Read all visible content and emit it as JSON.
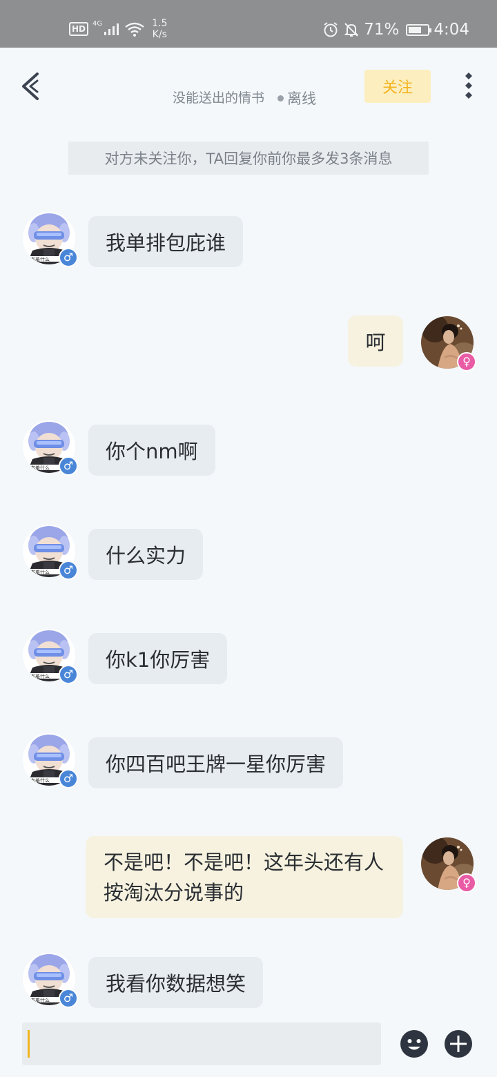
{
  "status_bar": {
    "hd": "HD",
    "network": "4G",
    "speed_value": "1.5",
    "speed_unit": "K/s",
    "battery_percent": "71%",
    "battery_level": 0.71,
    "time": "4:04",
    "icons": [
      "signal-icon",
      "wifi-icon",
      "alarm-icon",
      "mute-icon",
      "battery-icon"
    ]
  },
  "header": {
    "title": "没能送出的情书",
    "status": "离线",
    "follow_label": "关注",
    "icons": [
      "back-icon",
      "more-icon"
    ]
  },
  "notice": "对方未关注你，TA回复你前你最多发3条消息",
  "messages": [
    {
      "side": "left",
      "text": "我单排包庇谁",
      "gender": "♂"
    },
    {
      "side": "right",
      "text": "呵",
      "gender": "♀"
    },
    {
      "side": "left",
      "text": "你个nm啊",
      "gender": "♂"
    },
    {
      "side": "left",
      "text": "什么实力",
      "gender": "♂"
    },
    {
      "side": "left",
      "text": "你k1你厉害",
      "gender": "♂"
    },
    {
      "side": "left",
      "text": "你四百吧王牌一星你厉害",
      "gender": "♂"
    },
    {
      "side": "right",
      "text": "不是吧！不是吧！这年头还有人按淘汰分说事的",
      "gender": "♀"
    },
    {
      "side": "left",
      "text": "我看你数据想笑",
      "gender": "♂"
    }
  ],
  "input": {
    "value": "",
    "icons": [
      "emoji-icon",
      "plus-icon"
    ]
  },
  "colors": {
    "accent": "#f2b41f",
    "follow_bg": "#fdeec0",
    "bubble_left": "#e7ecf0",
    "bubble_right": "#f6f2df",
    "male": "#4a86d8",
    "female": "#e95ba5"
  }
}
